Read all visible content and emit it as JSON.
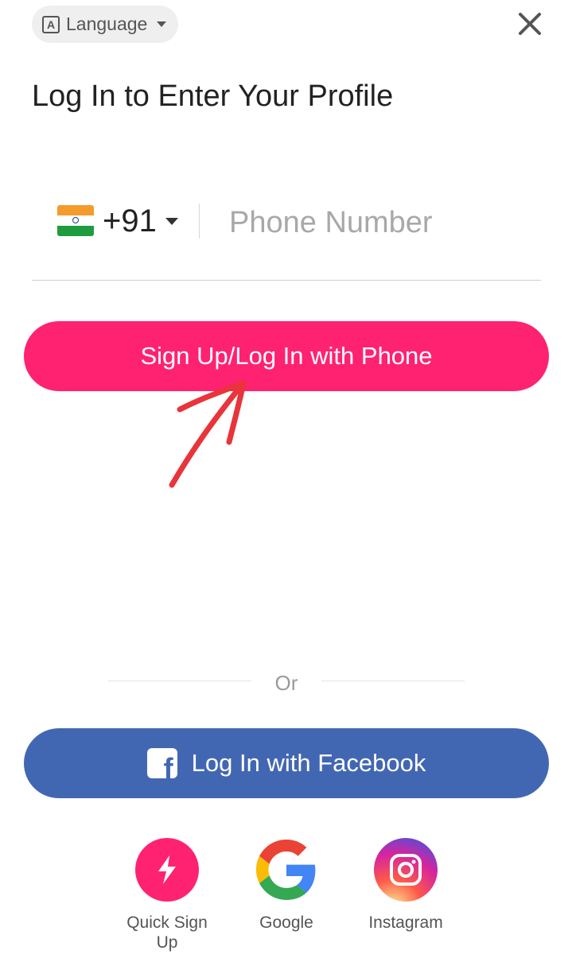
{
  "header": {
    "language_label": "Language",
    "language_icon_glyph": "A"
  },
  "title": "Log In to Enter Your Profile",
  "phone": {
    "country_code": "+91",
    "flag": "india-flag",
    "placeholder": "Phone Number",
    "value": ""
  },
  "primary_button": "Sign Up/Log In with Phone",
  "divider_text": "Or",
  "facebook_button": "Log In with Facebook",
  "socials": [
    {
      "label": "Quick Sign Up",
      "icon": "lightning-icon"
    },
    {
      "label": "Google",
      "icon": "google-icon"
    },
    {
      "label": "Instagram",
      "icon": "instagram-icon"
    }
  ],
  "colors": {
    "primary": "#ff2270",
    "facebook": "#4267b2",
    "annotation_arrow": "#e8343a"
  }
}
